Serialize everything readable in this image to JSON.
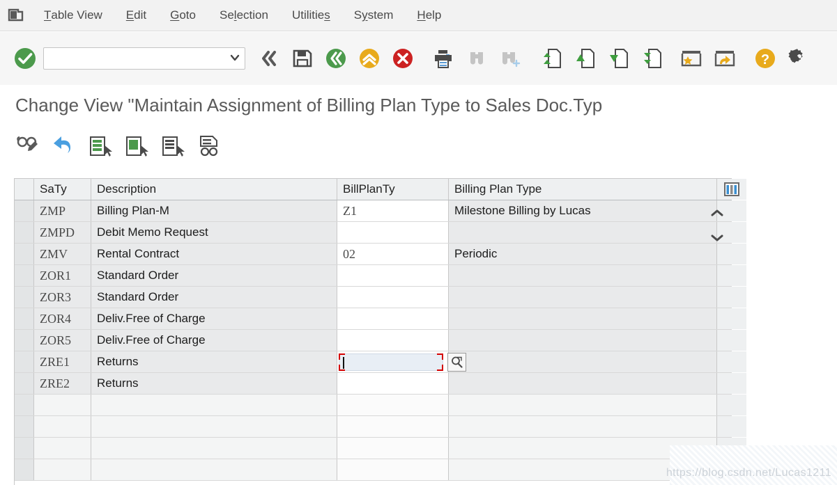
{
  "window": {
    "logo_icon": "sap-table-view-icon"
  },
  "menubar": {
    "items": [
      {
        "label": "Table View",
        "accel": "T",
        "name": "menu-table-view"
      },
      {
        "label": "Edit",
        "accel": "E",
        "name": "menu-edit"
      },
      {
        "label": "Goto",
        "accel": "G",
        "name": "menu-goto"
      },
      {
        "label": "Selection",
        "accel": "l",
        "name": "menu-selection"
      },
      {
        "label": "Utilities",
        "accel": "s",
        "name": "menu-utilities"
      },
      {
        "label": "System",
        "accel": "y",
        "name": "menu-system"
      },
      {
        "label": "Help",
        "accel": "H",
        "name": "menu-help"
      }
    ]
  },
  "toolbar": {
    "enter_icon": "green-check-icon",
    "command_field": {
      "value": "",
      "placeholder": ""
    },
    "dropdown_icon": "chevron-down-icon",
    "buttons": [
      {
        "name": "back-button",
        "icon": "double-chevron-left-icon",
        "title": "Back"
      },
      {
        "name": "save-button",
        "icon": "save-floppy-icon",
        "title": "Save"
      },
      {
        "name": "exit-button",
        "icon": "green-back-icon",
        "title": "Back"
      },
      {
        "name": "up-button",
        "icon": "yellow-exit-icon",
        "title": "Exit"
      },
      {
        "name": "cancel-button",
        "icon": "red-cancel-icon",
        "title": "Cancel"
      },
      {
        "name": "print-button",
        "icon": "printer-icon",
        "title": "Print"
      },
      {
        "name": "find-button",
        "icon": "binoculars-icon",
        "title": "Find"
      },
      {
        "name": "find-next-button",
        "icon": "binoculars-plus-icon",
        "title": "Find Next"
      },
      {
        "name": "first-page-button",
        "icon": "first-page-icon",
        "title": "First Page"
      },
      {
        "name": "previous-page-button",
        "icon": "previous-page-icon",
        "title": "Previous Page"
      },
      {
        "name": "next-page-button",
        "icon": "next-page-icon",
        "title": "Next Page"
      },
      {
        "name": "last-page-button",
        "icon": "last-page-icon",
        "title": "Last Page"
      },
      {
        "name": "create-shortcut-button",
        "icon": "star-window-icon",
        "title": "Create Shortcut"
      },
      {
        "name": "customize-layout-button",
        "icon": "arrow-window-icon",
        "title": "Customize Local Layout"
      },
      {
        "name": "help-button",
        "icon": "question-mark-icon",
        "title": "Help"
      },
      {
        "name": "settings-button",
        "icon": "gear-icon",
        "title": "Customizing of Local Layout"
      }
    ]
  },
  "title": {
    "text": "Change View \"Maintain Assignment of Billing Plan Type to Sales Doc.Typ"
  },
  "apptoolbar": {
    "buttons": [
      {
        "name": "display-change-button",
        "icon": "glasses-pencil-icon",
        "title": "Display/Change"
      },
      {
        "name": "undo-button",
        "icon": "undo-arrow-icon",
        "title": "Undo"
      },
      {
        "name": "new-entries-button",
        "icon": "new-entries-icon",
        "title": "New Entries"
      },
      {
        "name": "copy-as-button",
        "icon": "copy-as-icon",
        "title": "Copy As"
      },
      {
        "name": "delete-button",
        "icon": "delete-entry-icon",
        "title": "Delete"
      },
      {
        "name": "details-button",
        "icon": "details-glasses-icon",
        "title": "Details"
      }
    ]
  },
  "table": {
    "config_icon": "table-settings-icon",
    "scroll_up_icon": "chevron-up-icon",
    "scroll_down_icon": "chevron-down-icon",
    "search_help_icon": "search-help-magnifier-icon",
    "columns": [
      {
        "key": "saty",
        "label": "SaTy"
      },
      {
        "key": "description",
        "label": "Description"
      },
      {
        "key": "billplanty",
        "label": "BillPlanTy"
      },
      {
        "key": "billing_plan_type",
        "label": "Billing Plan Type"
      }
    ],
    "rows": [
      {
        "saty": "ZMP",
        "description": "Billing Plan-M",
        "billplanty": "Z1",
        "billing_plan_type": "Milestone Billing by Lucas",
        "focused": false
      },
      {
        "saty": "ZMPD",
        "description": "Debit Memo Request",
        "billplanty": "",
        "billing_plan_type": "",
        "focused": false
      },
      {
        "saty": "ZMV",
        "description": "Rental Contract",
        "billplanty": "02",
        "billing_plan_type": "Periodic",
        "focused": false
      },
      {
        "saty": "ZOR1",
        "description": "Standard Order",
        "billplanty": "",
        "billing_plan_type": "",
        "focused": false
      },
      {
        "saty": "ZOR3",
        "description": "Standard Order",
        "billplanty": "",
        "billing_plan_type": "",
        "focused": false
      },
      {
        "saty": "ZOR4",
        "description": "Deliv.Free of Charge",
        "billplanty": "",
        "billing_plan_type": "",
        "focused": false
      },
      {
        "saty": "ZOR5",
        "description": "Deliv.Free of Charge",
        "billplanty": "",
        "billing_plan_type": "",
        "focused": false
      },
      {
        "saty": "ZRE1",
        "description": "Returns",
        "billplanty": "",
        "billing_plan_type": "",
        "focused": true
      },
      {
        "saty": "ZRE2",
        "description": "Returns",
        "billplanty": "",
        "billing_plan_type": "",
        "focused": false
      }
    ],
    "empty_row_count": 4
  },
  "watermark": {
    "text": "https://blog.csdn.net/Lucas1211"
  },
  "colors": {
    "accent_green": "#2e8b2e",
    "accent_yellow": "#e8aa1c",
    "accent_red": "#cc2222",
    "focus_red": "#d40000",
    "toolbar_bg": "#f6f6f6",
    "header_bg": "#eef0f1",
    "row_bg": "#e9eaeb",
    "input_bg": "#ffffff"
  }
}
